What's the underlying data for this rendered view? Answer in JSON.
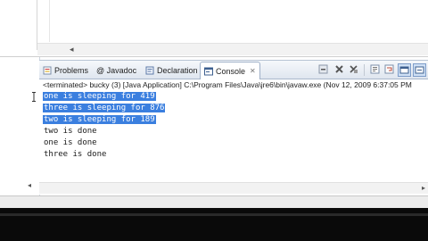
{
  "tabs": [
    {
      "label": "Problems",
      "icon": "problems-icon",
      "selected": false
    },
    {
      "label": "@ Javadoc",
      "icon": "javadoc-icon",
      "selected": false
    },
    {
      "label": "Declaration",
      "icon": "declaration-icon",
      "selected": false
    },
    {
      "label": "Console",
      "icon": "console-icon",
      "selected": true,
      "close": "✕"
    }
  ],
  "toolbar": {
    "icons": [
      "remove-launch-icon",
      "terminate-icon",
      "remove-all-terminated-icon",
      "scroll-lock-icon",
      "word-wrap-icon",
      "pin-console-icon",
      "display-selected-console-icon"
    ]
  },
  "console": {
    "status": "<terminated> bucky (3) [Java Application] C:\\Program Files\\Java\\jre6\\bin\\javaw.exe (Nov 12, 2009 6:37:05 PM",
    "lines": [
      {
        "text": "one is sleeping for 419",
        "selected": true
      },
      {
        "text": "three is sleeping for 876",
        "selected": true
      },
      {
        "text": "two is sleeping for 189",
        "selected": true
      },
      {
        "text": "two is done",
        "selected": false
      },
      {
        "text": "one is done",
        "selected": false
      },
      {
        "text": "three is done",
        "selected": false
      }
    ]
  },
  "colors": {
    "selection": "#3b7fdf",
    "tabbar_top": "#f6f8fb",
    "tabbar_bottom": "#dfe6ef"
  }
}
